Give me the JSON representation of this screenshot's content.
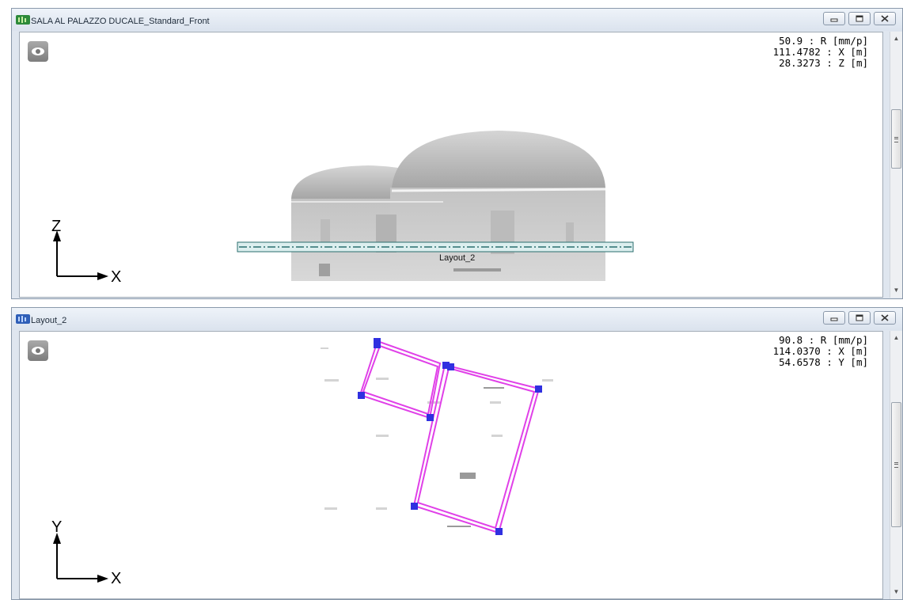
{
  "windows": {
    "front": {
      "title": "SALA AL PALAZZO DUCALE_Standard_Front",
      "readout": {
        "line1": "50.9 : R [mm/p]",
        "line2": "111.4782 : X [m]",
        "line3": "28.3273 : Z [m]"
      },
      "axes": {
        "vertical": "Z",
        "horizontal": "X"
      },
      "section_label": "Layout_2"
    },
    "plan": {
      "title": "Layout_2",
      "readout": {
        "line1": "90.8 : R [mm/p]",
        "line2": "114.0370 : X [m]",
        "line3": "54.6578 : Y [m]"
      },
      "axes": {
        "vertical": "Y",
        "horizontal": "X"
      }
    }
  },
  "colors": {
    "layout_outline": "#e040e8",
    "layout_vertex": "#3030e0",
    "section_line": "#2a6e6e"
  },
  "icons": {
    "app": "pointcloud-app-icon",
    "visibility": "eye-icon",
    "minimize": "minimize-icon",
    "restore": "restore-icon",
    "close": "close-icon"
  }
}
